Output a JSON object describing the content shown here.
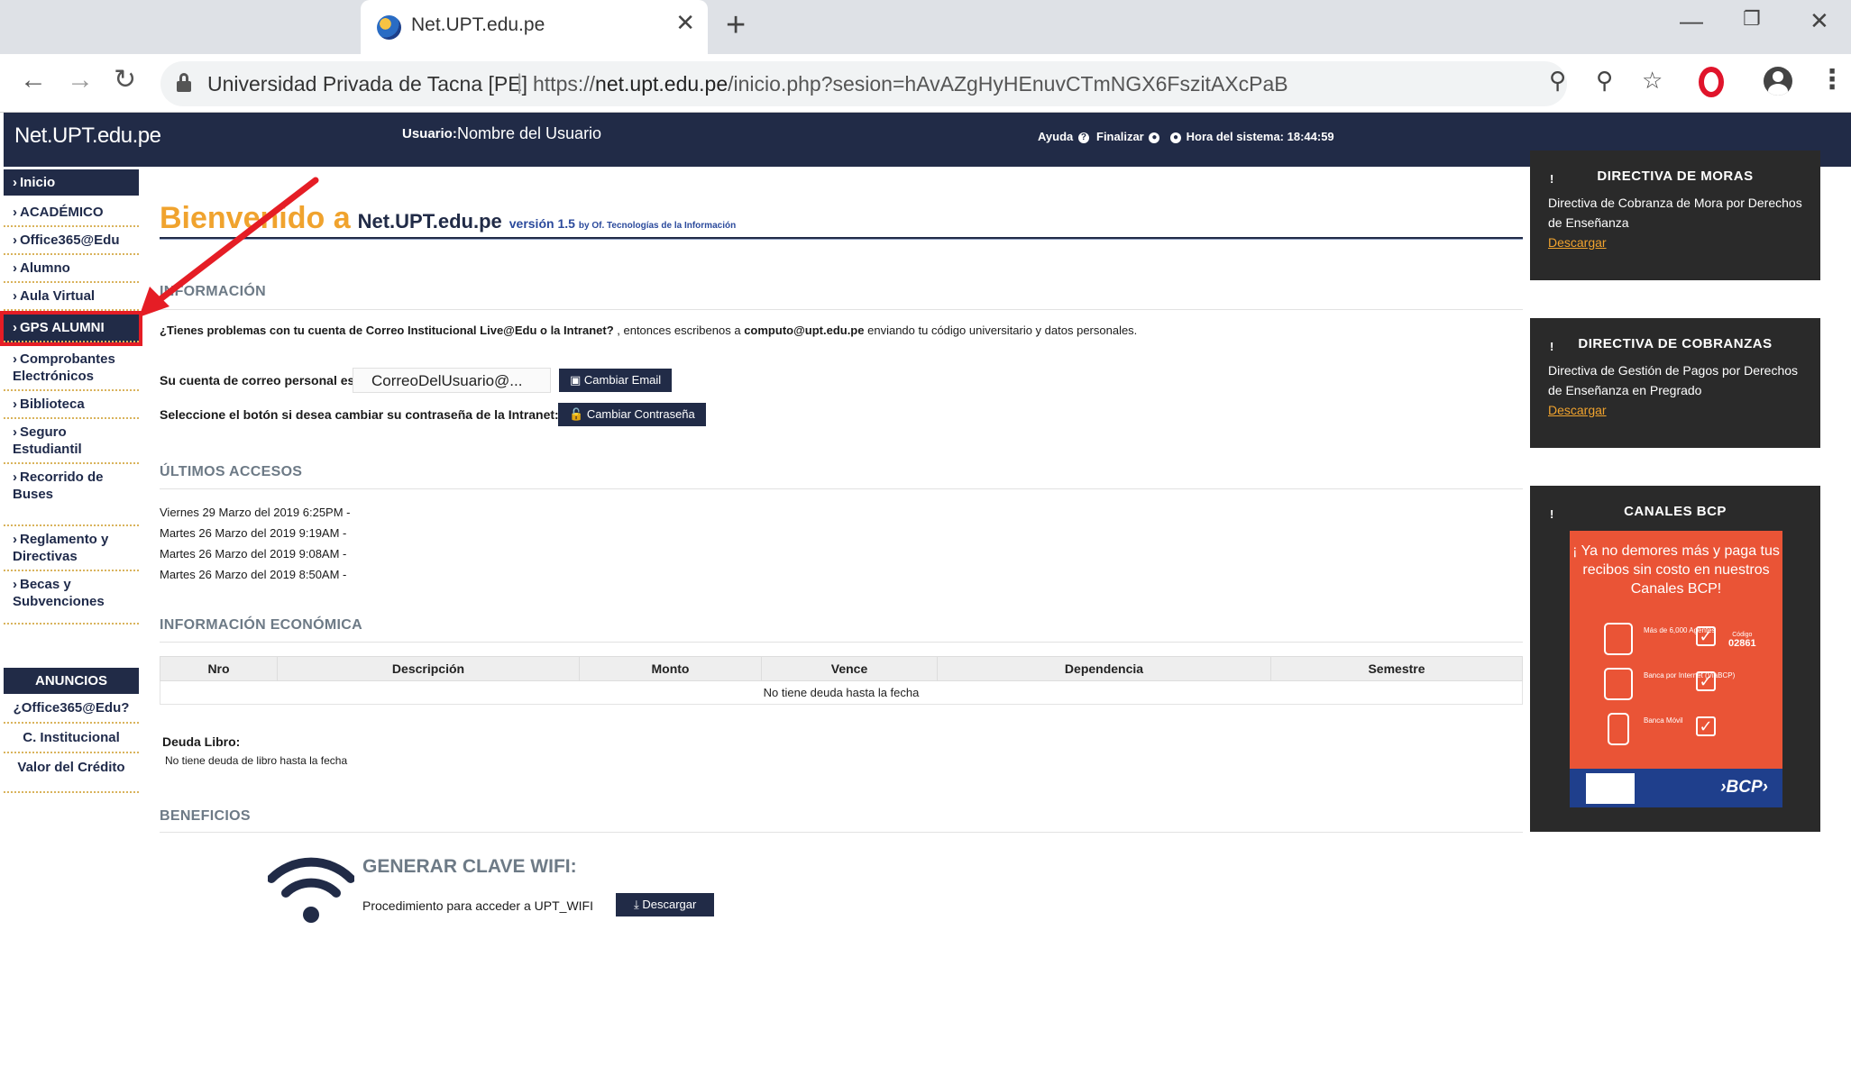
{
  "browser": {
    "tab_title": "Net.UPT.edu.pe",
    "tab_close": "✕",
    "new_tab": "+",
    "site_name": "Universidad Privada de Tacna [PE]",
    "url_prefix": "https://",
    "url_host": "net.upt.edu.pe",
    "url_path": "/inicio.php?sesion=hAvAZgHyHEnuvCTmNGX6FszitAXcPaB"
  },
  "header": {
    "brand": "Net.UPT.edu.pe",
    "user_label": "Usuario:",
    "user_name": "Nombre del Usuario",
    "help": "Ayuda",
    "logout": "Finalizar",
    "clock": "Hora del sistema: 18:44:59"
  },
  "sidebar": {
    "items": [
      {
        "label": "Inicio"
      },
      {
        "label": "ACADÉMICO"
      },
      {
        "label": "Office365@Edu"
      },
      {
        "label": "Alumno"
      },
      {
        "label": "Aula Virtual"
      },
      {
        "label": "GPS ALUMNI"
      },
      {
        "label": "Comprobantes Electrónicos"
      },
      {
        "label": "Biblioteca"
      },
      {
        "label": "Seguro Estudiantil"
      },
      {
        "label": "Recorrido de Buses"
      },
      {
        "label": "Reglamento y Directivas"
      },
      {
        "label": "Becas y Subvenciones"
      }
    ],
    "announcements_title": "ANUNCIOS",
    "announcements": [
      {
        "label": "¿Office365@Edu?"
      },
      {
        "label": "C. Institucional"
      },
      {
        "label": "Valor del Crédito"
      }
    ]
  },
  "main": {
    "welcome_1": "Bienvenido a",
    "welcome_2": "Net.UPT.edu.pe",
    "welcome_3": "versión 1.5",
    "welcome_4": "by Of. Tecnologías de la Información",
    "info_title": "INFORMACIÓN",
    "info_q": "¿Tienes problemas con tu cuenta de Correo Institucional Live@Edu o la Intranet?",
    "info_mid": ", entonces escribenos a",
    "info_email": "computo@upt.edu.pe",
    "info_end": "enviando tu código universitario y datos personales.",
    "email_label": "Su cuenta de correo personal es:",
    "email_value": "CorreoDelUsuario@...",
    "change_email_btn": "Cambiar Email",
    "pwd_label": "Seleccione el botón si desea cambiar su contraseña de la Intranet:",
    "change_pwd_btn": "Cambiar Contraseña",
    "access_title": "ÚLTIMOS ACCESOS",
    "accesses": [
      "Viernes 29 Marzo del 2019 6:25PM -",
      "Martes 26 Marzo del 2019 9:19AM -",
      "Martes 26 Marzo del 2019 9:08AM -",
      "Martes 26 Marzo del 2019 8:50AM -"
    ],
    "econ_title": "INFORMACIÓN ECONÓMICA",
    "table": {
      "headers": [
        "Nro",
        "Descripción",
        "Monto",
        "Vence",
        "Dependencia",
        "Semestre"
      ],
      "empty_msg": "No tiene deuda hasta la fecha"
    },
    "book_debt_label": "Deuda Libro:",
    "book_debt_msg": "No tiene deuda de libro hasta la fecha",
    "benefits_title": "BENEFICIOS",
    "wifi_title": "GENERAR CLAVE WIFI:",
    "wifi_desc": "Procedimiento para acceder a UPT_WIFI",
    "wifi_btn": "Descargar"
  },
  "cards": [
    {
      "title": "DIRECTIVA DE MORAS",
      "body": "Directiva de Cobranza de Mora por Derechos de Enseñanza",
      "link": "Descargar"
    },
    {
      "title": "DIRECTIVA DE COBRANZAS",
      "body": "Directiva de Gestión de Pagos por Derechos de Enseñanza en Pregrado",
      "link": "Descargar"
    },
    {
      "title": "CANALES BCP",
      "ad_text": "¡ Ya no demores más y paga tus recibos sin costo en nuestros Canales BCP!",
      "rows": [
        {
          "label": "Más de 6,000 Agentes",
          "code_label": "Código",
          "code": "02861"
        },
        {
          "label": "Banca por Internet (ViaBCP)",
          "code_label": "",
          "code": ""
        },
        {
          "label": "Banca Móvil",
          "code_label": "",
          "code": ""
        }
      ],
      "brand": "›BCP›"
    }
  ],
  "colors": {
    "navy": "#212b47",
    "orange": "#f0a32e",
    "bcp_orange": "#ea5436",
    "highlight_red": "#e51d25"
  }
}
